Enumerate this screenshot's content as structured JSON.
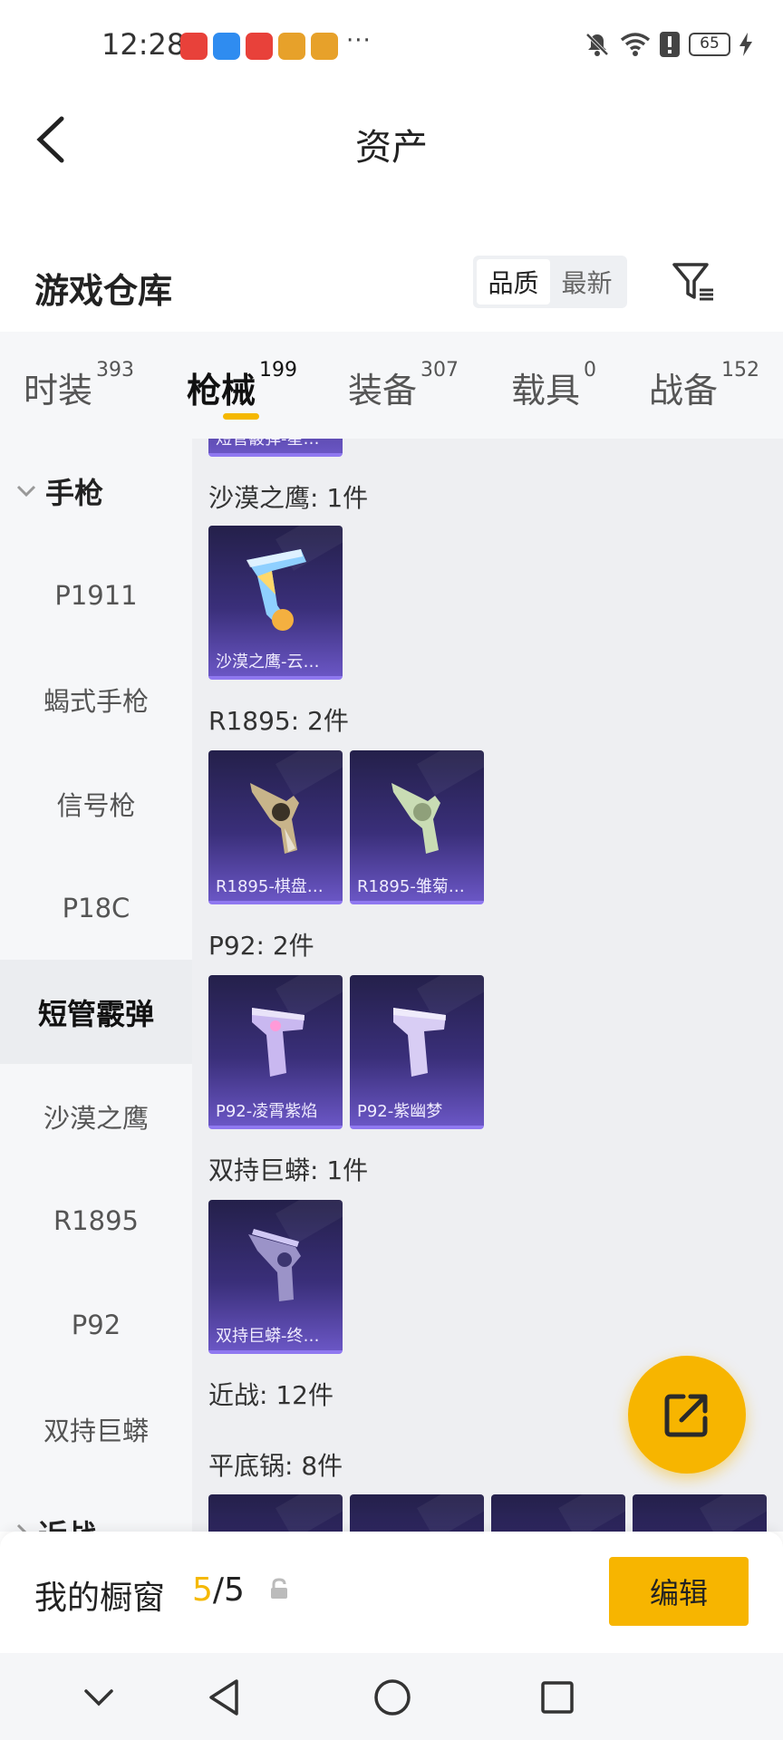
{
  "status_bar": {
    "time": "12:28",
    "more": "···",
    "battery": "65"
  },
  "header": {
    "title": "资产"
  },
  "section": {
    "title": "游戏仓库",
    "sort_options": [
      "品质",
      "最新"
    ]
  },
  "tabs": [
    {
      "label": "时装",
      "count": "393"
    },
    {
      "label": "枪械",
      "count": "199"
    },
    {
      "label": "装备",
      "count": "307"
    },
    {
      "label": "载具",
      "count": "0"
    },
    {
      "label": "战备",
      "count": "152"
    }
  ],
  "sidebar": {
    "group_pistol": "手枪",
    "items": [
      "P1911",
      "蝎式手枪",
      "信号枪",
      "P18C",
      "短管霰弹",
      "沙漠之鹰",
      "R1895",
      "P92",
      "双持巨蟒"
    ],
    "group_melee": "近战"
  },
  "content": {
    "top_card_name": "短管霰弹-星…",
    "groups": [
      {
        "label": "沙漠之鹰: 1件",
        "cards": [
          "沙漠之鹰-云…"
        ]
      },
      {
        "label": "R1895: 2件",
        "cards": [
          "R1895-棋盘…",
          "R1895-雏菊…"
        ]
      },
      {
        "label": "P92: 2件",
        "cards": [
          "P92-凌霄紫焰",
          "P92-紫幽梦"
        ]
      },
      {
        "label": "双持巨蟒: 1件",
        "cards": [
          "双持巨蟒-终…"
        ]
      },
      {
        "label": "近战: 12件",
        "cards": []
      },
      {
        "label": "平底锅: 8件",
        "cards": []
      }
    ]
  },
  "showcase": {
    "label": "我的橱窗",
    "count": "5",
    "total": "/5",
    "edit_label": "编辑"
  },
  "colors": {
    "accent": "#f7b500",
    "card_top": "#24204a",
    "card_bottom": "#6a56c4"
  }
}
